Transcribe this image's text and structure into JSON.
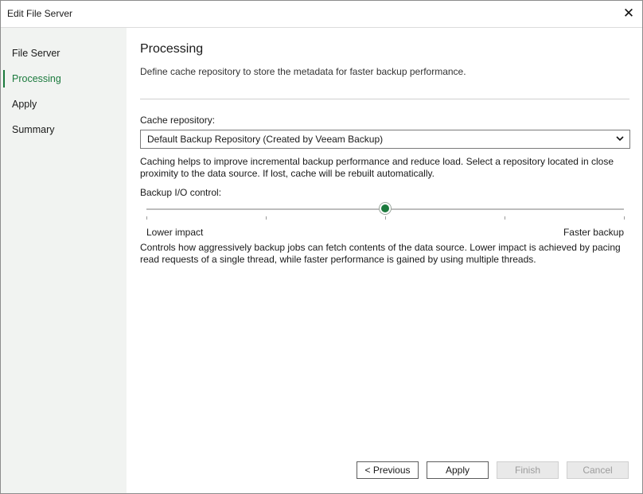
{
  "window": {
    "title": "Edit File Server",
    "close_icon": "close-icon"
  },
  "sidebar": {
    "items": [
      {
        "label": "File Server",
        "active": false
      },
      {
        "label": "Processing",
        "active": true
      },
      {
        "label": "Apply",
        "active": false
      },
      {
        "label": "Summary",
        "active": false
      }
    ],
    "accent_color": "#1b7a3d"
  },
  "main": {
    "title": "Processing",
    "description": "Define cache repository to store the metadata for faster backup performance.",
    "cache_repository": {
      "label": "Cache repository:",
      "selected": "Default Backup Repository (Created by Veeam Backup)"
    },
    "cache_help": "Caching helps to improve incremental backup performance and reduce load. Select a repository located in close proximity to the data source. If lost, cache will be rebuilt automatically.",
    "io_control": {
      "label": "Backup I/O control:",
      "value": 0.5,
      "tick_count": 5,
      "min_label": "Lower impact",
      "max_label": "Faster backup"
    },
    "io_help": "Controls how aggressively backup jobs can fetch contents of the data source. Lower impact is achieved by pacing read requests of a single thread, while faster performance is gained by using multiple threads."
  },
  "buttons": {
    "previous": "< Previous",
    "apply": "Apply",
    "finish": "Finish",
    "cancel": "Cancel"
  }
}
